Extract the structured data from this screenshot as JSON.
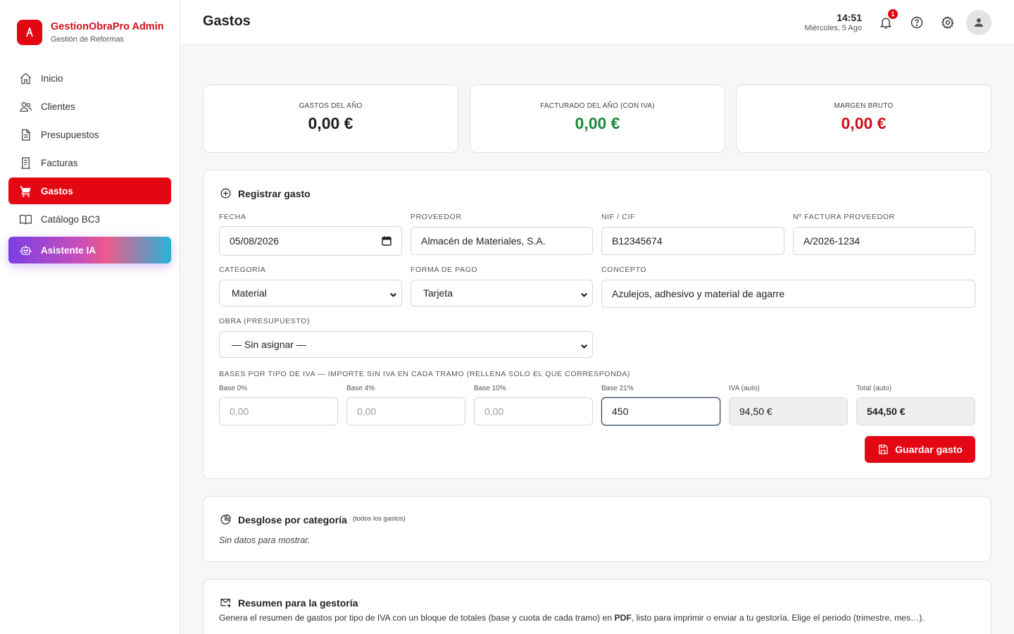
{
  "brand": {
    "title": "GestionObraPro Admin",
    "subtitle": "Gestión de Reformas",
    "logo_glyph": "A"
  },
  "sidebar": {
    "items": [
      {
        "label": "Inicio",
        "icon": "home-icon"
      },
      {
        "label": "Clientes",
        "icon": "users-icon"
      },
      {
        "label": "Presupuestos",
        "icon": "document-icon"
      },
      {
        "label": "Facturas",
        "icon": "invoice-icon"
      },
      {
        "label": "Gastos",
        "icon": "cart-icon",
        "active": true
      },
      {
        "label": "Catálogo BC3",
        "icon": "book-icon"
      },
      {
        "label": "Asistente IA",
        "icon": "robot-icon"
      }
    ]
  },
  "header": {
    "title": "Gastos",
    "time": "14:51",
    "date": "Miércoles, 5 Ago",
    "notification_count": "1"
  },
  "stats": [
    {
      "label": "Gastos del año",
      "value": "0,00 €",
      "color": "#1f1f1f"
    },
    {
      "label": "Facturado del año (con IVA)",
      "value": "0,00 €",
      "color": "#1a8a3a"
    },
    {
      "label": "Margen bruto",
      "value": "0,00 €",
      "color": "#d0101b"
    }
  ],
  "form": {
    "title": "Registrar gasto",
    "fecha": {
      "label": "Fecha",
      "value": "05/08/2026"
    },
    "proveedor": {
      "label": "Proveedor",
      "value": "Almacén de Materiales, S.A."
    },
    "nif": {
      "label": "NIF / CIF",
      "value": "B12345674"
    },
    "factura": {
      "label": "Nº factura proveedor",
      "value": "A/2026-1234"
    },
    "categoria": {
      "label": "Categoría",
      "value": "Material"
    },
    "forma_pago": {
      "label": "Forma de pago",
      "value": "Tarjeta"
    },
    "concepto": {
      "label": "Concepto",
      "value": "Azulejos, adhesivo y material de agarre"
    },
    "obra": {
      "label": "Obra (presupuesto)",
      "value": "— Sin asignar —"
    },
    "bases_title": "Bases por tipo de IVA — importe sin IVA en cada tramo (rellena solo el que corresponda)",
    "bases": [
      {
        "label": "Base 0%",
        "value": "",
        "placeholder": "0,00"
      },
      {
        "label": "Base 4%",
        "value": "",
        "placeholder": "0,00"
      },
      {
        "label": "Base 10%",
        "value": "",
        "placeholder": "0,00"
      },
      {
        "label": "Base 21%",
        "value": "450",
        "placeholder": "0,00"
      }
    ],
    "iva": {
      "label": "IVA (auto)",
      "value": "94,50 €"
    },
    "total": {
      "label": "Total (auto)",
      "value": "544,50 €"
    },
    "save_label": "Guardar gasto"
  },
  "desglose": {
    "title": "Desglose por categoría",
    "note": "(todos los gastos)",
    "empty": "Sin datos para mostrar."
  },
  "resumen": {
    "title": "Resumen para la gestoría",
    "text_before": "Genera el resumen de gastos por tipo de IVA con un bloque de totales (base y cuota de cada tramo) en ",
    "text_bold": "PDF",
    "text_after": ", listo para imprimir o enviar a tu gestoría. Elige el periodo (trimestre, mes…)."
  }
}
